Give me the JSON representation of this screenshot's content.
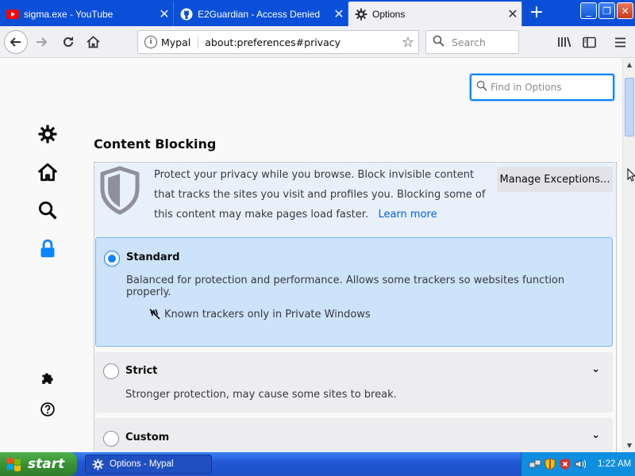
{
  "tabs": [
    {
      "label": "sigma.exe - YouTube",
      "icon": "youtube-icon"
    },
    {
      "label": "E2Guardian - Access Denied",
      "icon": "github-icon"
    },
    {
      "label": "Options",
      "icon": "gear-icon",
      "active": true
    }
  ],
  "new_tab": "+",
  "window_buttons": {
    "minimize": "_",
    "maximize": "❐",
    "close": "✕"
  },
  "navbar": {
    "identity": "Mypal",
    "url": "about:preferences#privacy",
    "search_placeholder": "Search"
  },
  "find": {
    "placeholder": "Find in Options"
  },
  "categories": [
    {
      "name": "general",
      "icon": "gear-icon"
    },
    {
      "name": "home",
      "icon": "home-icon"
    },
    {
      "name": "search",
      "icon": "search-icon"
    },
    {
      "name": "privacy",
      "icon": "lock-icon",
      "selected": true
    },
    {
      "name": "addons",
      "icon": "puzzle-icon"
    },
    {
      "name": "support",
      "icon": "help-icon"
    }
  ],
  "content_blocking": {
    "title": "Content Blocking",
    "description": "Protect your privacy while you browse. Block invisible content that tracks the sites you visit and profiles you. Blocking some of this content may make pages load faster.",
    "learn_more": "Learn more",
    "manage_button": "Manage Exceptions...",
    "options": {
      "standard": {
        "title": "Standard",
        "desc": "Balanced for protection and performance. Allows some trackers so websites function properly.",
        "tracker_note": "Known trackers only in Private Windows",
        "checked": true
      },
      "strict": {
        "title": "Strict",
        "desc": "Stronger protection, may cause some sites to break.",
        "checked": false
      },
      "custom": {
        "title": "Custom",
        "checked": false
      }
    }
  },
  "taskbar": {
    "start": "start",
    "task": "Options - Mypal",
    "clock": "1:22 AM"
  },
  "colors": {
    "tabbar": "#0a4fd7",
    "accent": "#0a84ff",
    "selected_option_bg": "#cce3fb",
    "taskbar": "#2259d6",
    "start_button": "#3a9235"
  }
}
